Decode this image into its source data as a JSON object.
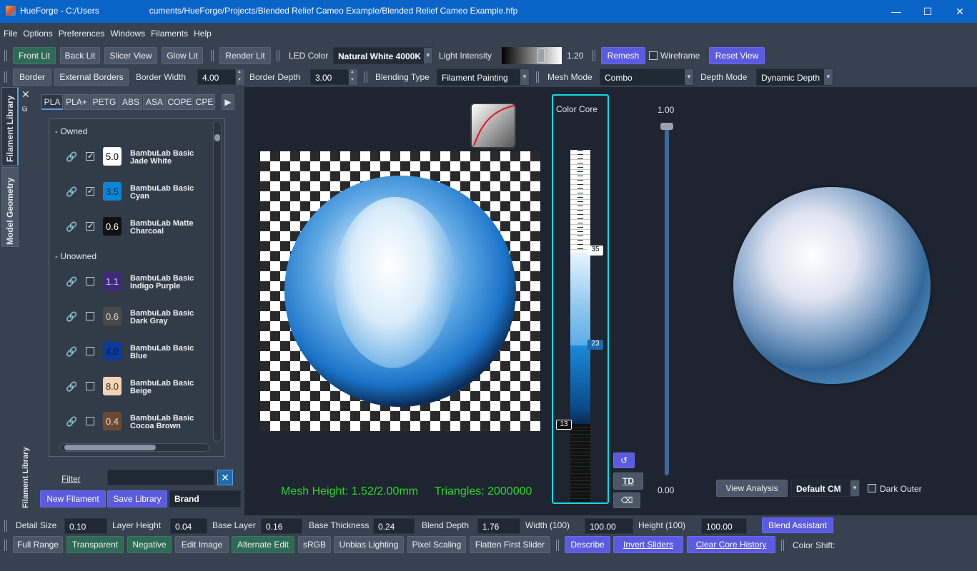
{
  "window": {
    "title": "HueForge - C:/Users                     cuments/HueForge/Projects/Blended Relief Cameo Example/Blended Relief Cameo Example.hfp",
    "minimize": "—",
    "maximize": "☐",
    "close": "✕"
  },
  "menu": [
    "File",
    "Options",
    "Preferences",
    "Windows",
    "Filaments",
    "Help"
  ],
  "toolbar1": {
    "front_lit": "Front Lit",
    "back_lit": "Back Lit",
    "slicer_view": "Slicer View",
    "glow_lit": "Glow Lit",
    "render_lit": "Render Lit",
    "led_color_label": "LED Color",
    "led_color_value": "Natural White 4000K",
    "light_intensity_label": "Light Intensity",
    "light_intensity_value": "1.20",
    "remesh": "Remesh",
    "wireframe": "Wireframe",
    "reset_view": "Reset View"
  },
  "toolbar2": {
    "border": "Border",
    "external_borders": "External Borders",
    "border_width_label": "Border Width",
    "border_width_value": "4.00",
    "border_depth_label": "Border Depth",
    "border_depth_value": "3.00",
    "blending_type_label": "Blending Type",
    "blending_type_value": "Filament Painting",
    "mesh_mode_label": "Mesh Mode",
    "mesh_mode_value": "Combo",
    "depth_mode_label": "Depth Mode",
    "depth_mode_value": "Dynamic Depth"
  },
  "side_tabs": {
    "library": "Filament Library",
    "geometry": "Model Geometry",
    "dock_label": "Filament Library"
  },
  "library": {
    "tabs": [
      "PLA",
      "PLA+",
      "PETG",
      "ABS",
      "ASA",
      "COPE",
      "CPE"
    ],
    "owned_header": "- Owned",
    "unowned_header": "- Unowned",
    "owned": [
      {
        "td": "5.0",
        "name1": "BambuLab Basic",
        "name2": "Jade White",
        "color": "#ffffff",
        "text": "#000000",
        "checked": true
      },
      {
        "td": "3.5",
        "name1": "BambuLab Basic",
        "name2": "Cyan",
        "color": "#0a86d8",
        "text": "#0b2a4a",
        "checked": true
      },
      {
        "td": "0.6",
        "name1": "BambuLab Matte",
        "name2": "Charcoal",
        "color": "#111111",
        "text": "#ffffff",
        "checked": true
      }
    ],
    "unowned": [
      {
        "td": "1.1",
        "name1": "BambuLab Basic",
        "name2": "Indigo Purple",
        "color": "#3f2a7a",
        "text": "#c9c0ef",
        "checked": false
      },
      {
        "td": "0.6",
        "name1": "BambuLab Basic",
        "name2": "Dark Gray",
        "color": "#4a4a4a",
        "text": "#d8d8d8",
        "checked": false
      },
      {
        "td": "4.0",
        "name1": "BambuLab Basic",
        "name2": "Blue",
        "color": "#0a3a9a",
        "text": "#0a1a40",
        "checked": false
      },
      {
        "td": "8.0",
        "name1": "BambuLab Basic",
        "name2": "Beige",
        "color": "#f1d5b5",
        "text": "#3a2a1a",
        "checked": false
      },
      {
        "td": "0.4",
        "name1": "BambuLab Basic",
        "name2": "Cocoa Brown",
        "color": "#6b4a35",
        "text": "#f0dcc8",
        "checked": false
      }
    ],
    "filter_label": "Filter",
    "new_filament": "New Filament",
    "save_library": "Save Library",
    "brand_value": "Brand"
  },
  "viewport": {
    "mesh_height": "Mesh Height: 1.52/2.00mm",
    "triangles": "Triangles: 2000000",
    "color_core_title": "Color Core",
    "marker_top": "35",
    "marker_mid": "23",
    "marker_low": "13",
    "td_button": "TD",
    "slider_max": "1.00",
    "slider_min": "0.00",
    "view_analysis": "View Analysis",
    "colormap_value": "Default CM",
    "dark_outer": "Dark Outer"
  },
  "toolbar3": {
    "detail_size_label": "Detail Size",
    "detail_size_value": "0.10",
    "layer_height_label": "Layer Height",
    "layer_height_value": "0.04",
    "base_layer_label": "Base Layer",
    "base_layer_value": "0.16",
    "base_thickness_label": "Base Thickness",
    "base_thickness_value": "0.24",
    "blend_depth_label": "Blend Depth",
    "blend_depth_value": "1.76",
    "width_label": "Width (100)",
    "width_value": "100.00",
    "height_label": "Height (100)",
    "height_value": "100.00",
    "blend_assistant": "Blend Assistant"
  },
  "toolbar4": {
    "full_range": "Full Range",
    "transparent": "Transparent",
    "negative": "Negative",
    "edit_image": "Edit Image",
    "alternate_edit": "Alternate Edit",
    "srgb": "sRGB",
    "unbias_lighting": "Unbias Lighting",
    "pixel_scaling": "Pixel Scaling",
    "flatten_first_slider": "Flatten First Slider",
    "describe": "Describe",
    "invert_sliders": "Invert Sliders",
    "clear_core_history": "Clear Core History",
    "color_shift": "Color Shift:"
  },
  "colors": {
    "accent_purple": "#5b5be0",
    "accent_green": "#2e6a55",
    "color_core_border": "#19d6e6",
    "mesh_text": "#2ed52e"
  }
}
